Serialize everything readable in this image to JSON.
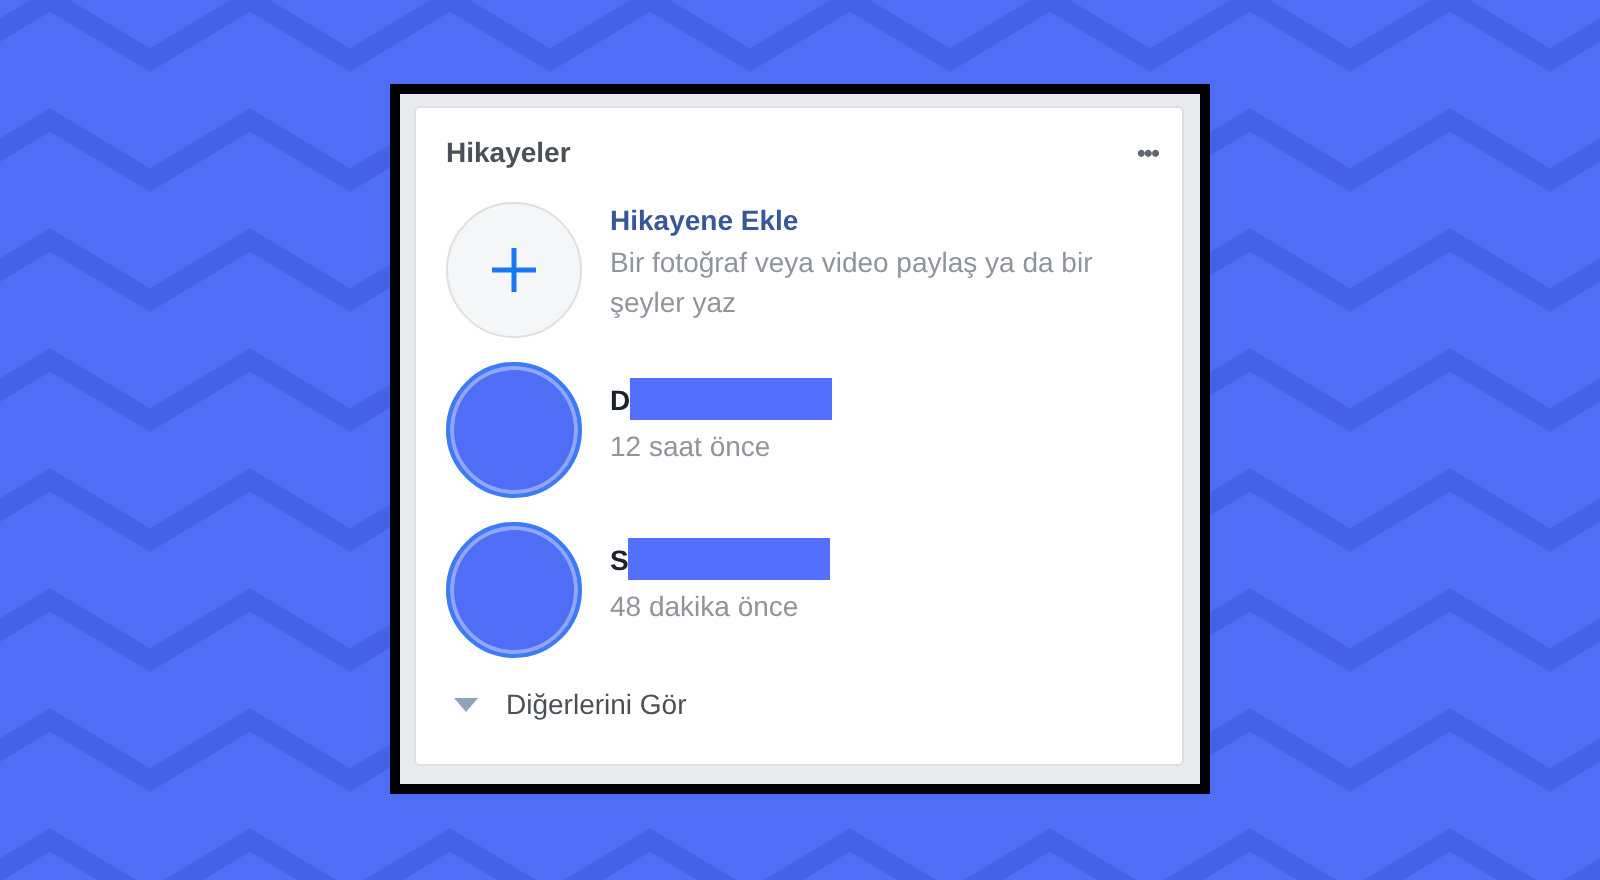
{
  "panel": {
    "title": "Hikayeler",
    "more": "•••"
  },
  "stories": [
    {
      "kind": "add",
      "title": "Hikayene Ekle",
      "subtitle": "Bir fotoğraf veya video paylaş ya da bir şeyler yaz"
    },
    {
      "kind": "story",
      "title": "D",
      "redacted": true,
      "subtitle": "12 saat önce"
    },
    {
      "kind": "story",
      "title": "S",
      "redacted": true,
      "subtitle": "48 dakika önce"
    }
  ],
  "see_more": {
    "label": "Diğerlerini Gör",
    "expanded": false
  }
}
